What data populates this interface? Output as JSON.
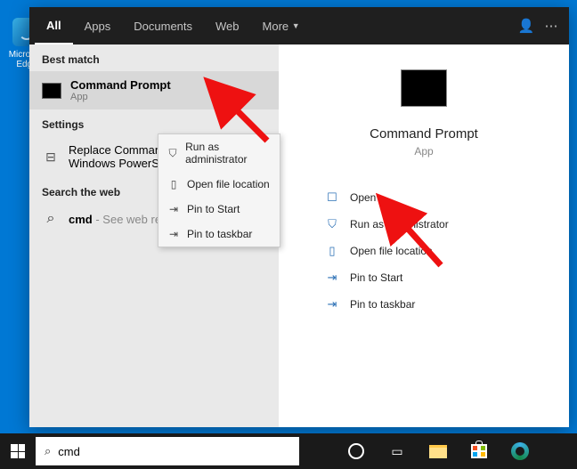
{
  "desktop": {
    "edge_label": "Microsoft Edge"
  },
  "tabs": {
    "all": "All",
    "apps": "Apps",
    "documents": "Documents",
    "web": "Web",
    "more": "More"
  },
  "left": {
    "best_match": "Best match",
    "cmd_title": "Command Prompt",
    "cmd_sub": "App",
    "settings": "Settings",
    "settings_item": "Replace Command Prompt with Windows PowerShell",
    "search_web": "Search the web",
    "web_item": "cmd",
    "web_item_sub": " - See web results"
  },
  "context": {
    "run_admin": "Run as administrator",
    "open_loc": "Open file location",
    "pin_start": "Pin to Start",
    "pin_taskbar": "Pin to taskbar"
  },
  "right": {
    "title": "Command Prompt",
    "sub": "App",
    "open": "Open",
    "run_admin": "Run as administrator",
    "open_loc": "Open file location",
    "pin_start": "Pin to Start",
    "pin_taskbar": "Pin to taskbar"
  },
  "taskbar": {
    "search_value": "cmd"
  }
}
